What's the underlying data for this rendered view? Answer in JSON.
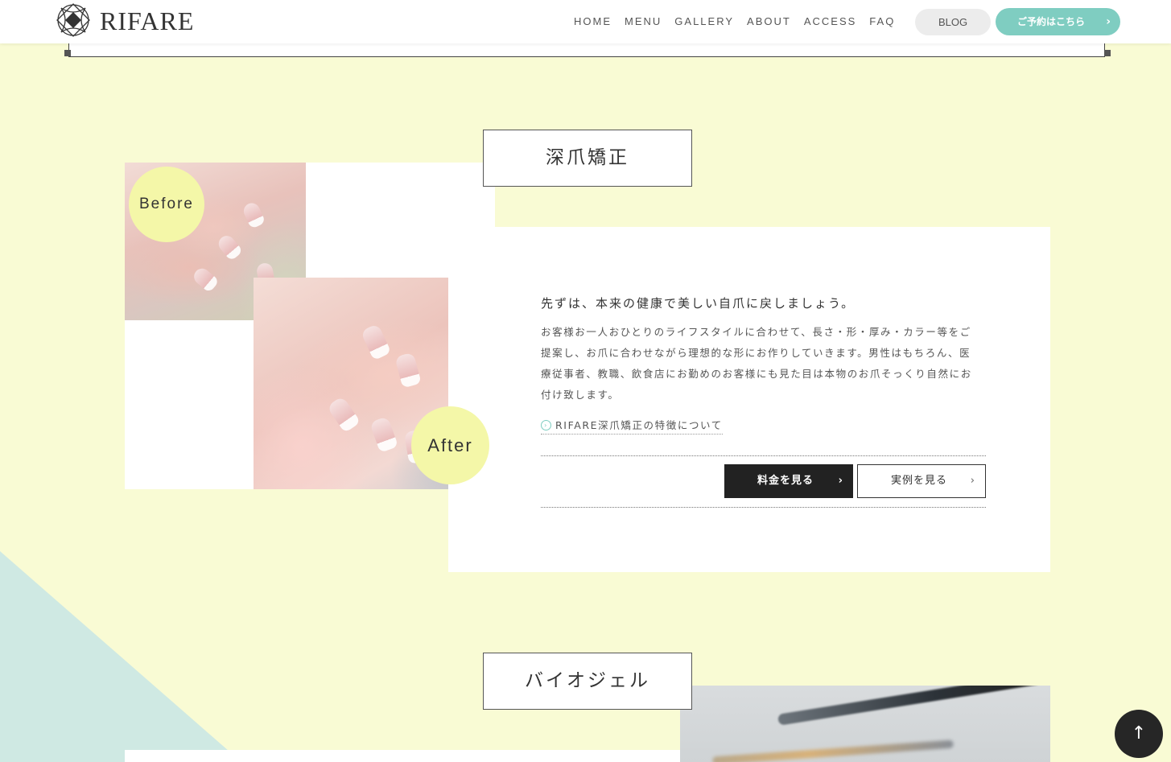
{
  "header": {
    "logo_text": "RIFARE",
    "nav": [
      "HOME",
      "MENU",
      "GALLERY",
      "ABOUT",
      "ACCESS",
      "FAQ"
    ],
    "blog_label": "BLOG",
    "reserve_label": "ご予約はこちら",
    "reserve_icon": "chevron-right-icon"
  },
  "section1": {
    "title": "深爪矯正",
    "before_label": "Before",
    "after_label": "After",
    "headline": "先ずは、本来の健康で美しい自爪に戻しましょう。",
    "body": "お客様お一人おひとりのライフスタイルに合わせて、長さ・形・厚み・カラー等をご提案し、お爪に合わせながら理想的な形にお作りしていきます。男性はもちろん、医療従事者、教職、飲食店にお勤めのお客様にも見た目は本物のお爪そっくり自然にお付け致します。",
    "detail_link": "RIFARE深爪矯正の特徴について",
    "price_button": "料金を見る",
    "example_button": "実例を見る"
  },
  "section2": {
    "title": "バイオジェル"
  },
  "colors": {
    "background": "#f9fbd4",
    "accent": "#7fcdc1",
    "badge": "#f4f7a8",
    "triangle": "#cfe9e3",
    "dark": "#222222"
  },
  "back_to_top_icon": "arrow-up-icon"
}
